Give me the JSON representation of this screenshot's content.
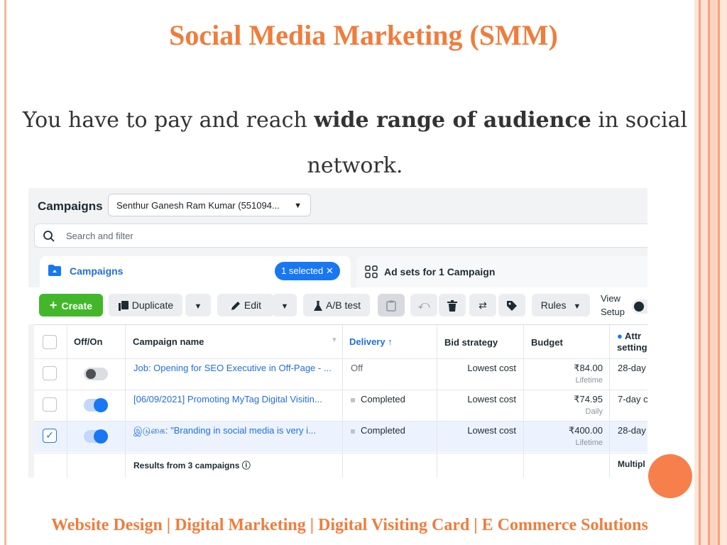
{
  "slide": {
    "title": "Social Media Marketing (SMM)",
    "body_prefix": "You have to pay and reach ",
    "body_bold": "wide range of audience",
    "body_suffix": " in social network.",
    "footer": "Website Design | Digital Marketing | Digital Visiting Card | E Commerce  Solutions"
  },
  "ads_manager": {
    "title": "Campaigns",
    "account": "Senthur Ganesh Ram Kumar (551094...",
    "search_placeholder": "Search and filter",
    "tabs": {
      "campaigns": "Campaigns",
      "selected_pill": "1 selected  ✕",
      "ad_sets": "Ad sets for 1 Campaign"
    },
    "toolbar": {
      "create": "Create",
      "duplicate": "Duplicate",
      "edit": "Edit",
      "ab_test": "A/B test",
      "rules": "Rules",
      "view_setup_1": "View",
      "view_setup_2": "Setup"
    },
    "columns": {
      "off_on": "Off/On",
      "campaign_name": "Campaign name",
      "delivery": "Delivery ↑",
      "bid_strategy": "Bid strategy",
      "budget": "Budget",
      "attr_1": "Attr",
      "attr_2": "setting"
    },
    "rows": [
      {
        "name": "Job: Opening for SEO Executive in Off-Page - ...",
        "delivery": "Off",
        "bid": "Lowest cost",
        "budget": "₹84.00",
        "budget_type": "Lifetime",
        "attr": "28-day",
        "on": false,
        "selected": false
      },
      {
        "name": "[06/09/2021] Promoting MyTag Digital Visitin...",
        "delivery": "Completed",
        "bid": "Lowest cost",
        "budget": "₹74.95",
        "budget_type": "Daily",
        "attr": "7-day c",
        "on": true,
        "selected": false
      },
      {
        "name": "இடுகை: \"Branding in social media is very i...",
        "delivery": "Completed",
        "bid": "Lowest cost",
        "budget": "₹400.00",
        "budget_type": "Lifetime",
        "attr": "28-day",
        "on": true,
        "selected": true
      }
    ],
    "results_label": "Results from 3 campaigns",
    "results_attr": "Multipl"
  },
  "colors": {
    "accent_orange": "#ef7d3d",
    "link_blue": "#216fdb",
    "create_green": "#42b72a",
    "pill_blue": "#1877f2"
  }
}
